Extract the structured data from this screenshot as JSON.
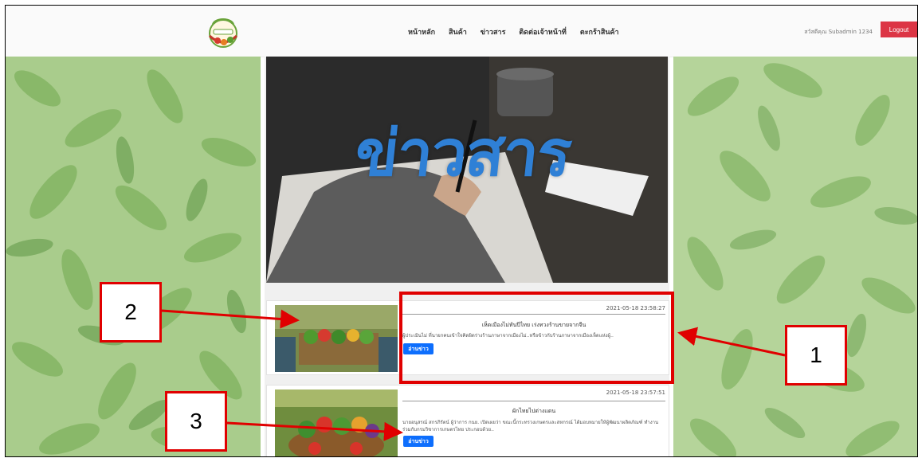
{
  "navbar": {
    "logo_alt": "shop-logo",
    "items": [
      "หน้าหลัก",
      "สินค้า",
      "ข่าวสาร",
      "ติดต่อเจ้าหน้าที่",
      "ตะกร้าสินค้า"
    ],
    "greeting": "สวัสดีคุณ Subadmin 1234",
    "logout": "Logout"
  },
  "hero": {
    "title": "ข่าวสาร"
  },
  "news": [
    {
      "date": "2021-05-18 23:58:27",
      "title": "เห็ดเมืองไม่ทันปีไทย เร่งทวงร้านขายจากจีน",
      "excerpt": "ผู้ประเมินไม่ ที่นายกคนเข้าใจคิดผิดร่างร้านภาษาจากเมืองไม่..หรือข้าวกับร้านภาษาจากเมืองเห็ดแห่งผู้..",
      "button": "อ่านข่าว"
    },
    {
      "date": "2021-05-18 23:57:51",
      "title": "ผักไทยไปต่างแดน",
      "excerpt": "นายอนุสรณ์ สกรภิรัตน์ ผู้ว่าการ กนย. เปิดเผยว่า ขณะนี้กระทรวงเกษตรและสหกรณ์ ได้มอบหมายให้ผู้พัฒนาผลิตภัณฑ์ ทำงานร่วมกับกรมวิชาการเกษตรไทย ประกอบด้วย..",
      "button": "อ่านข่าว"
    }
  ],
  "annotations": [
    "1",
    "2",
    "3"
  ],
  "colors": {
    "logout": "#dc3545",
    "read_button": "#0d6efd",
    "annotation": "#e00000",
    "hero_title": "#2f80d6"
  }
}
